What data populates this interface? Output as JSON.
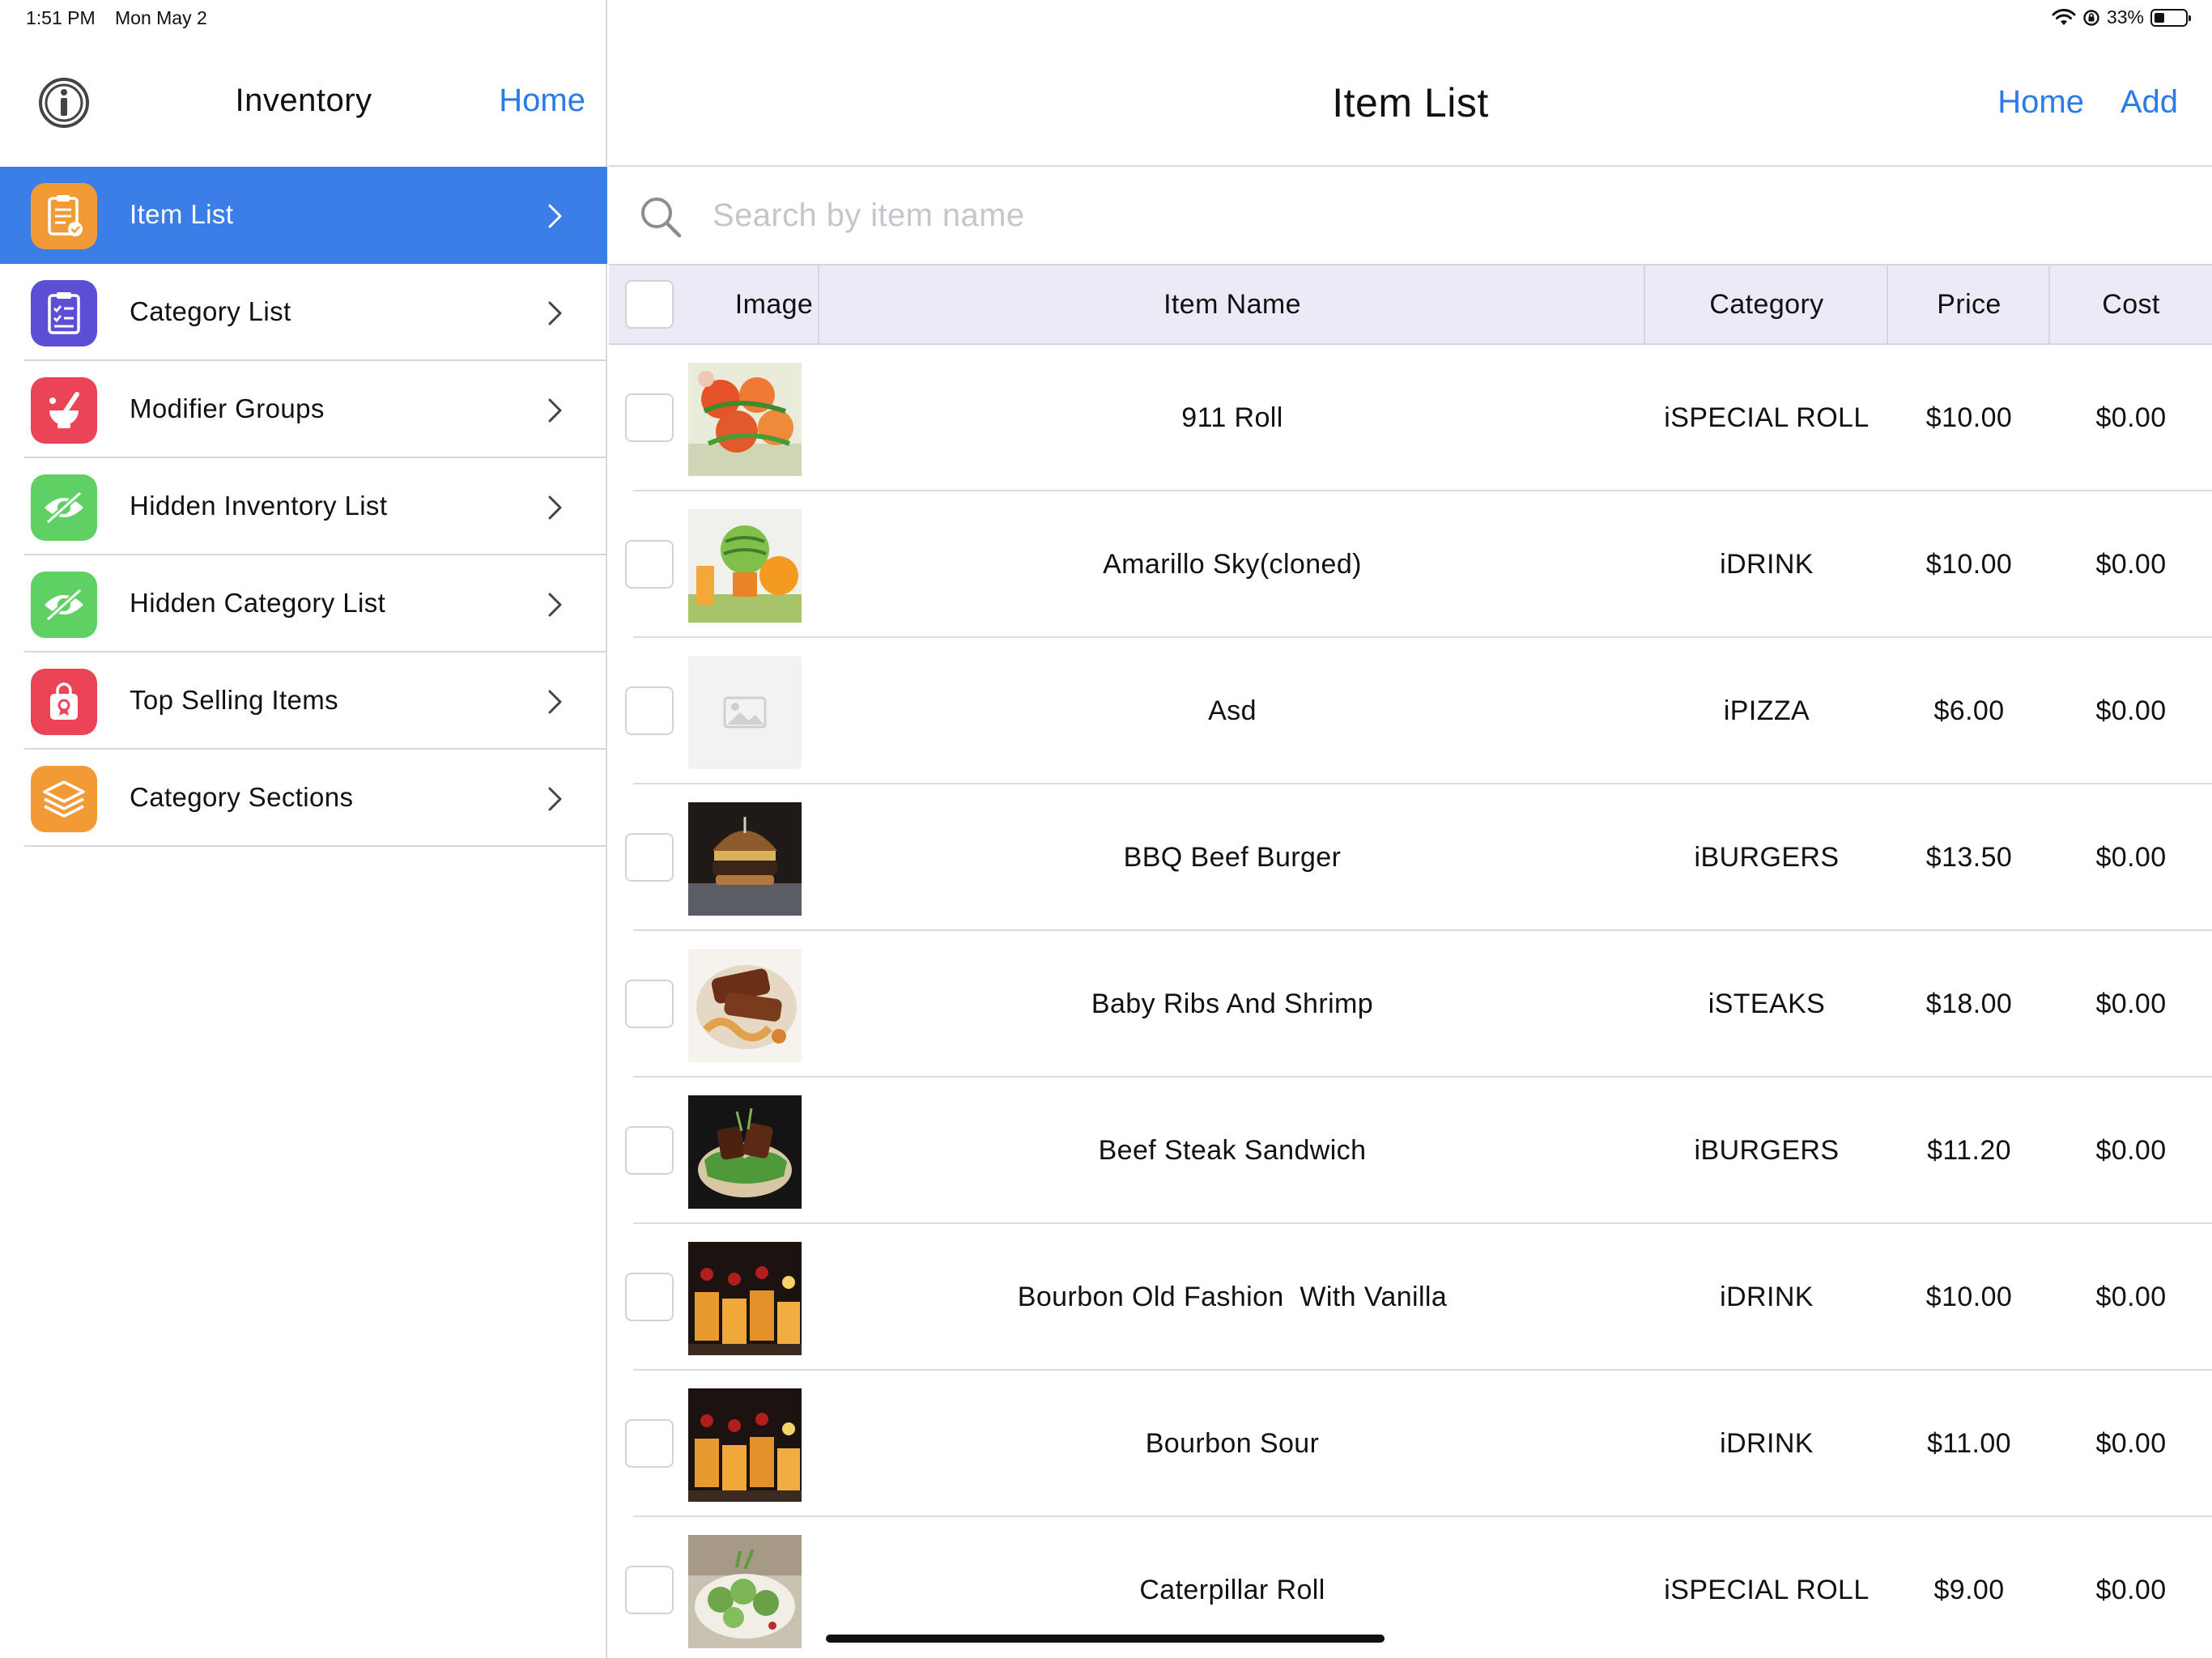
{
  "status_bar": {
    "time": "1:51 PM",
    "date": "Mon May 2",
    "battery": "33%",
    "battery_level": 0.33
  },
  "sidebar": {
    "title": "Inventory",
    "home_label": "Home",
    "items": [
      {
        "label": "Item List",
        "icon": "clipboard-check-icon",
        "color": "#f29a35",
        "active": true
      },
      {
        "label": "Category List",
        "icon": "checklist-icon",
        "color": "#5b4fd6",
        "active": false
      },
      {
        "label": "Modifier Groups",
        "icon": "mortar-pestle-icon",
        "color": "#eb4457",
        "active": false
      },
      {
        "label": "Hidden Inventory List",
        "icon": "eye-slash-icon",
        "color": "#5fd063",
        "active": false
      },
      {
        "label": "Hidden Category List",
        "icon": "eye-slash-icon",
        "color": "#5fd063",
        "active": false
      },
      {
        "label": "Top Selling Items",
        "icon": "shopping-bag-award-icon",
        "color": "#eb4457",
        "active": false
      },
      {
        "label": "Category Sections",
        "icon": "layers-icon",
        "color": "#f29a35",
        "active": false
      }
    ]
  },
  "main": {
    "title": "Item List",
    "home_label": "Home",
    "add_label": "Add",
    "search": {
      "placeholder": "Search by item name",
      "value": ""
    },
    "columns": [
      "Image",
      "Item Name",
      "Category",
      "Price",
      "Cost"
    ],
    "rows": [
      {
        "name": "911 Roll",
        "category": "iSPECIAL ROLL",
        "price": "$10.00",
        "cost": "$0.00",
        "image": "sushi-roll-photo"
      },
      {
        "name": "Amarillo Sky(cloned)",
        "category": "iDRINK",
        "price": "$10.00",
        "cost": "$0.00",
        "image": "melon-drink-photo"
      },
      {
        "name": "Asd",
        "category": "iPIZZA",
        "price": "$6.00",
        "cost": "$0.00",
        "image": "placeholder-image"
      },
      {
        "name": "BBQ Beef Burger",
        "category": "iBURGERS",
        "price": "$13.50",
        "cost": "$0.00",
        "image": "burger-photo"
      },
      {
        "name": "Baby Ribs And Shrimp",
        "category": "iSTEAKS",
        "price": "$18.00",
        "cost": "$0.00",
        "image": "ribs-photo"
      },
      {
        "name": "Beef Steak Sandwich",
        "category": "iBURGERS",
        "price": "$11.20",
        "cost": "$0.00",
        "image": "steak-photo"
      },
      {
        "name": "Bourbon Old Fashion  With Vanilla",
        "category": "iDRINK",
        "price": "$10.00",
        "cost": "$0.00",
        "image": "cocktails-photo"
      },
      {
        "name": "Bourbon Sour",
        "category": "iDRINK",
        "price": "$11.00",
        "cost": "$0.00",
        "image": "cocktails-photo"
      },
      {
        "name": "Caterpillar Roll",
        "category": "iSPECIAL ROLL",
        "price": "$9.00",
        "cost": "$0.00",
        "image": "caterpillar-roll-photo"
      }
    ]
  },
  "colors": {
    "accent": "#2a7be6",
    "active_row": "#3b7ee8",
    "table_header": "#eaebf6"
  }
}
